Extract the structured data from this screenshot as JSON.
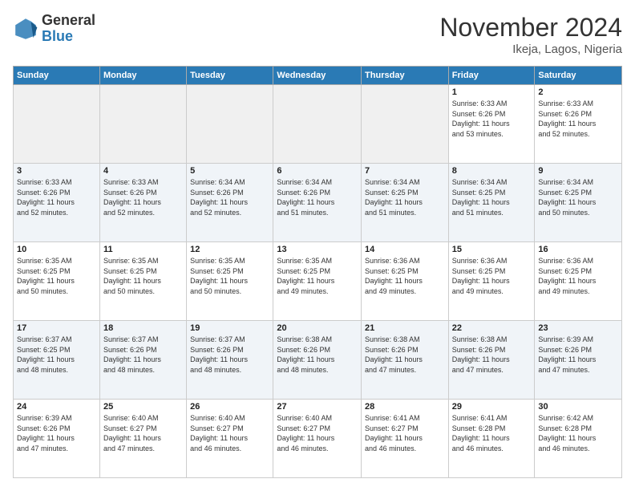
{
  "header": {
    "logo_general": "General",
    "logo_blue": "Blue",
    "month_title": "November 2024",
    "location": "Ikeja, Lagos, Nigeria"
  },
  "calendar": {
    "headers": [
      "Sunday",
      "Monday",
      "Tuesday",
      "Wednesday",
      "Thursday",
      "Friday",
      "Saturday"
    ],
    "weeks": [
      [
        {
          "day": "",
          "info": ""
        },
        {
          "day": "",
          "info": ""
        },
        {
          "day": "",
          "info": ""
        },
        {
          "day": "",
          "info": ""
        },
        {
          "day": "",
          "info": ""
        },
        {
          "day": "1",
          "info": "Sunrise: 6:33 AM\nSunset: 6:26 PM\nDaylight: 11 hours\nand 53 minutes."
        },
        {
          "day": "2",
          "info": "Sunrise: 6:33 AM\nSunset: 6:26 PM\nDaylight: 11 hours\nand 52 minutes."
        }
      ],
      [
        {
          "day": "3",
          "info": "Sunrise: 6:33 AM\nSunset: 6:26 PM\nDaylight: 11 hours\nand 52 minutes."
        },
        {
          "day": "4",
          "info": "Sunrise: 6:33 AM\nSunset: 6:26 PM\nDaylight: 11 hours\nand 52 minutes."
        },
        {
          "day": "5",
          "info": "Sunrise: 6:34 AM\nSunset: 6:26 PM\nDaylight: 11 hours\nand 52 minutes."
        },
        {
          "day": "6",
          "info": "Sunrise: 6:34 AM\nSunset: 6:26 PM\nDaylight: 11 hours\nand 51 minutes."
        },
        {
          "day": "7",
          "info": "Sunrise: 6:34 AM\nSunset: 6:25 PM\nDaylight: 11 hours\nand 51 minutes."
        },
        {
          "day": "8",
          "info": "Sunrise: 6:34 AM\nSunset: 6:25 PM\nDaylight: 11 hours\nand 51 minutes."
        },
        {
          "day": "9",
          "info": "Sunrise: 6:34 AM\nSunset: 6:25 PM\nDaylight: 11 hours\nand 50 minutes."
        }
      ],
      [
        {
          "day": "10",
          "info": "Sunrise: 6:35 AM\nSunset: 6:25 PM\nDaylight: 11 hours\nand 50 minutes."
        },
        {
          "day": "11",
          "info": "Sunrise: 6:35 AM\nSunset: 6:25 PM\nDaylight: 11 hours\nand 50 minutes."
        },
        {
          "day": "12",
          "info": "Sunrise: 6:35 AM\nSunset: 6:25 PM\nDaylight: 11 hours\nand 50 minutes."
        },
        {
          "day": "13",
          "info": "Sunrise: 6:35 AM\nSunset: 6:25 PM\nDaylight: 11 hours\nand 49 minutes."
        },
        {
          "day": "14",
          "info": "Sunrise: 6:36 AM\nSunset: 6:25 PM\nDaylight: 11 hours\nand 49 minutes."
        },
        {
          "day": "15",
          "info": "Sunrise: 6:36 AM\nSunset: 6:25 PM\nDaylight: 11 hours\nand 49 minutes."
        },
        {
          "day": "16",
          "info": "Sunrise: 6:36 AM\nSunset: 6:25 PM\nDaylight: 11 hours\nand 49 minutes."
        }
      ],
      [
        {
          "day": "17",
          "info": "Sunrise: 6:37 AM\nSunset: 6:25 PM\nDaylight: 11 hours\nand 48 minutes."
        },
        {
          "day": "18",
          "info": "Sunrise: 6:37 AM\nSunset: 6:26 PM\nDaylight: 11 hours\nand 48 minutes."
        },
        {
          "day": "19",
          "info": "Sunrise: 6:37 AM\nSunset: 6:26 PM\nDaylight: 11 hours\nand 48 minutes."
        },
        {
          "day": "20",
          "info": "Sunrise: 6:38 AM\nSunset: 6:26 PM\nDaylight: 11 hours\nand 48 minutes."
        },
        {
          "day": "21",
          "info": "Sunrise: 6:38 AM\nSunset: 6:26 PM\nDaylight: 11 hours\nand 47 minutes."
        },
        {
          "day": "22",
          "info": "Sunrise: 6:38 AM\nSunset: 6:26 PM\nDaylight: 11 hours\nand 47 minutes."
        },
        {
          "day": "23",
          "info": "Sunrise: 6:39 AM\nSunset: 6:26 PM\nDaylight: 11 hours\nand 47 minutes."
        }
      ],
      [
        {
          "day": "24",
          "info": "Sunrise: 6:39 AM\nSunset: 6:26 PM\nDaylight: 11 hours\nand 47 minutes."
        },
        {
          "day": "25",
          "info": "Sunrise: 6:40 AM\nSunset: 6:27 PM\nDaylight: 11 hours\nand 47 minutes."
        },
        {
          "day": "26",
          "info": "Sunrise: 6:40 AM\nSunset: 6:27 PM\nDaylight: 11 hours\nand 46 minutes."
        },
        {
          "day": "27",
          "info": "Sunrise: 6:40 AM\nSunset: 6:27 PM\nDaylight: 11 hours\nand 46 minutes."
        },
        {
          "day": "28",
          "info": "Sunrise: 6:41 AM\nSunset: 6:27 PM\nDaylight: 11 hours\nand 46 minutes."
        },
        {
          "day": "29",
          "info": "Sunrise: 6:41 AM\nSunset: 6:28 PM\nDaylight: 11 hours\nand 46 minutes."
        },
        {
          "day": "30",
          "info": "Sunrise: 6:42 AM\nSunset: 6:28 PM\nDaylight: 11 hours\nand 46 minutes."
        }
      ]
    ]
  }
}
